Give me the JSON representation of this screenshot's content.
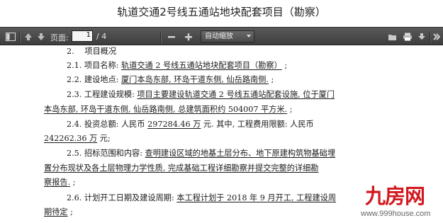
{
  "window": {
    "title": "轨道交通2号线五通站地块配套项目（勘察）"
  },
  "toolbar": {
    "page_label": "页面:",
    "page_current": "1",
    "page_total": "/ 4",
    "zoom_value": "自动缩放"
  },
  "document": {
    "lines": [
      {
        "pre": "2.　 项目概况",
        "u": "",
        "post": ""
      },
      {
        "pre": "2.1. 项目名称: ",
        "u": "轨道交通 2 号线五通站地块配套项目（勘察）",
        "post": " ;"
      },
      {
        "pre": "2.2. 建设地点: ",
        "u": "厦门本岛东部, 环岛干道东侧, 仙岳路南侧.",
        "post": " ;"
      },
      {
        "pre": "2.3. 工程建设规模: ",
        "u": "项目主要建设轨道交通 2 号线五通站配套设施, 位于厦门",
        "post": ""
      },
      {
        "pre": "",
        "u": "本岛东部, 环岛干道东侧, 仙岳路南侧, 总建筑面积约 504007 平方米.",
        "post": " ;"
      },
      {
        "pre": "2.4. 投资总额: 人民币 ",
        "u": "297284.46 万",
        "post": " 元. 其中, 工程费用限额: 人民币"
      },
      {
        "pre": "",
        "u": "242262.36 万",
        "post": " 元;"
      },
      {
        "pre": "2.5. 招标范围和内容: ",
        "u": "查明建设区域的地基土层分布、地下原建构筑物基础埋",
        "post": ""
      },
      {
        "pre": "",
        "u": "置分布现状及各土层物理力学性质, 完成基础工程详细勘察并提交完整的详细勘",
        "post": ""
      },
      {
        "pre": "",
        "u": "察报告.",
        "post": " ;"
      },
      {
        "pre": "2.6. 计划开工日期及建设周期: ",
        "u": "本工程计划于 2018 年 9 月开工, 工程建设周",
        "post": ""
      },
      {
        "pre": "",
        "u": "期待定",
        "post": " ;"
      }
    ]
  },
  "watermark": {
    "brand": "九房网",
    "site": "www.999house.com"
  },
  "colors": {
    "toolbar": "#4a4a4a",
    "watermark": "#d2191f"
  }
}
